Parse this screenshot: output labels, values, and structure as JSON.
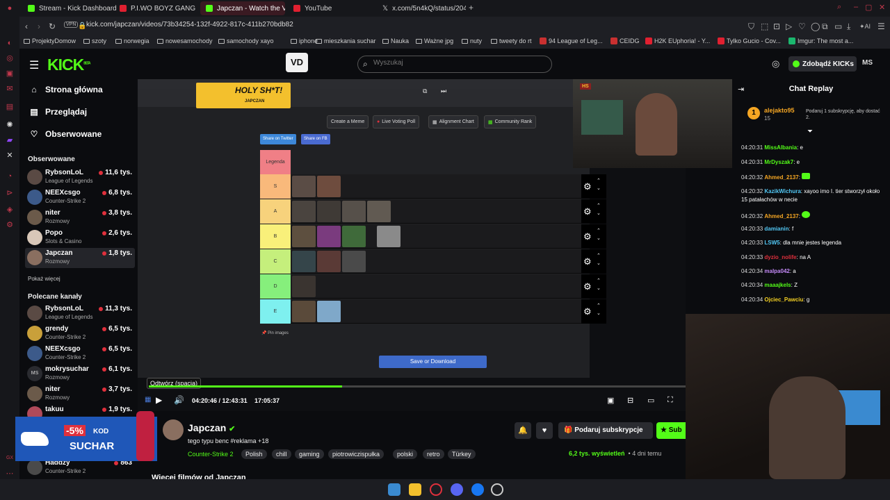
{
  "browser": {
    "tabs": [
      {
        "label": "Stream - Kick Dashboard",
        "color": "#53fc18"
      },
      {
        "label": "P.I.WO BOYZ GANG - SZO",
        "color": "#e02030"
      },
      {
        "label": "Japczan - Watch the VOD",
        "color": "#53fc18"
      },
      {
        "label": "YouTube",
        "color": "#e02030"
      },
      {
        "label": "x.com/5n4kQ/status/2048",
        "color": "#ffffff"
      }
    ],
    "url": "kick.com/japczan/videos/73b34254-132f-4922-817c-411b270bdb82",
    "vpn": "VPN",
    "bookmarks": [
      "ProjektyDomow",
      "szoty",
      "norwegia",
      "nowesamochody",
      "samochody xayo",
      "iphone",
      "mieszkania suchar",
      "Nauka",
      "Ważne jpg",
      "nuty",
      "tweety do rt",
      "94 League of Leg...",
      "CEIDG",
      "H2K EUphoria! - Y...",
      "Tylko Gucio - Cov...",
      "Imgur: The most a..."
    ]
  },
  "header": {
    "logo": "KICK",
    "logo_sup": "BETA",
    "vd_button": "VD",
    "search_placeholder": "Wyszukaj",
    "kicks_button": "Zdobądź KICKs",
    "avatar_initials": "MS"
  },
  "sidebar": {
    "nav": [
      {
        "label": "Strona główna",
        "icon": "home-icon"
      },
      {
        "label": "Przeglądaj",
        "icon": "browse-icon"
      },
      {
        "label": "Obserwowane",
        "icon": "heart-icon"
      }
    ],
    "followed_header": "Obserwowane",
    "followed": [
      {
        "name": "RybsonLoL",
        "game": "League of Legends",
        "viewers": "11,6 tys."
      },
      {
        "name": "NEEXcsgo",
        "game": "Counter-Strike 2",
        "viewers": "6,8 tys."
      },
      {
        "name": "niter",
        "game": "Rozmowy",
        "viewers": "3,8 tys."
      },
      {
        "name": "Popo",
        "game": "Slots & Casino",
        "viewers": "2,6 tys."
      },
      {
        "name": "Japczan",
        "game": "Rozmowy",
        "viewers": "1,8 tys."
      }
    ],
    "show_more": "Pokaż więcej",
    "recommended_header": "Polecane kanały",
    "recommended": [
      {
        "name": "RybsonLoL",
        "game": "League of Legends",
        "viewers": "11,3 tys."
      },
      {
        "name": "grendy",
        "game": "Counter-Strike 2",
        "viewers": "6,5 tys."
      },
      {
        "name": "NEEXcsgo",
        "game": "Counter-Strike 2",
        "viewers": "6,5 tys."
      },
      {
        "name": "mokrysuchar",
        "game": "Rozmowy",
        "viewers": "6,1 tys."
      },
      {
        "name": "niter",
        "game": "Rozmowy",
        "viewers": "3,7 tys."
      },
      {
        "name": "takuu",
        "game": "",
        "viewers": "1,9 tys."
      }
    ],
    "last_channel": {
      "name": "Haddzy",
      "game": "Counter-Strike 2",
      "viewers": "863"
    }
  },
  "video": {
    "overlay_banner": "HOLY SH*T!",
    "overlay_sub": "JAPCZAN",
    "meme_buttons": [
      "Create a Meme",
      "Live Voting Poll",
      "Alignment Chart",
      "Community Rank"
    ],
    "share_buttons": [
      "Share on Twitter",
      "Share on FB"
    ],
    "legend_label": "Legenda",
    "tiers": [
      {
        "label": "S",
        "color": "#f9b97b"
      },
      {
        "label": "A",
        "color": "#f7d27c"
      },
      {
        "label": "B",
        "color": "#f9f07a"
      },
      {
        "label": "C",
        "color": "#c5ef7c"
      },
      {
        "label": "D",
        "color": "#86ef7c"
      },
      {
        "label": "E",
        "color": "#7ef0ef"
      }
    ],
    "pin_images": "Pin images",
    "save_button": "Save or Download",
    "tooltip": "Odtwórz (spacja)",
    "time_current": "04:20:46",
    "time_total": "12:43:31",
    "time_clock": "17:05:37",
    "progress": 0.36
  },
  "chat": {
    "title": "Chat Replay",
    "sub_user": "alejakto95",
    "sub_count": "15",
    "sub_text": "Podaruj 1 subskrypcję, aby dostać 2.",
    "messages": [
      {
        "time": "04:20:31",
        "user": "MissAlbania",
        "color": "#53fc18",
        "text": "e"
      },
      {
        "time": "04:20:31",
        "user": "MrDyszak7",
        "color": "#53fc18",
        "text": "e"
      },
      {
        "time": "04:20:32",
        "user": "Ahmed_2137",
        "color": "#f5a623",
        "text": ""
      },
      {
        "time": "04:20:32",
        "user": "KazikWichura",
        "color": "#52c8f5",
        "text": "xayoo imo I. tier stworzył około 15 patałachów w necie"
      },
      {
        "time": "04:20:32",
        "user": "Ahmed_2137",
        "color": "#f5a623",
        "text": ""
      },
      {
        "time": "04:20:33",
        "user": "damianin",
        "color": "#52c8f5",
        "text": "f"
      },
      {
        "time": "04:20:33",
        "user": "LSW5",
        "color": "#52c8f5",
        "text": "dla mnie jestes legenda"
      },
      {
        "time": "04:20:33",
        "user": "dyzio_nolife",
        "color": "#e0303c",
        "text": "na A"
      },
      {
        "time": "04:20:34",
        "user": "malpa042",
        "color": "#c58af9",
        "text": "a"
      },
      {
        "time": "04:20:34",
        "user": "maaajkels",
        "color": "#53fc18",
        "text": "Z"
      },
      {
        "time": "04:20:34",
        "user": "Ojciec_Pawciu",
        "color": "#f5d123",
        "text": "g"
      }
    ]
  },
  "stream": {
    "name": "Japczan",
    "title": "tego typu benc  #reklama +18",
    "category": "Counter-Strike 2",
    "tags": [
      "Polish",
      "chill",
      "gaming",
      "piotrowiczispułka",
      "polski",
      "retro",
      "Türkey"
    ],
    "views": "6,2 tys. wyświetleń",
    "age": "4 dni temu",
    "gift_button": "Podaruj subskrypcje",
    "sub_button": "Sub",
    "more_videos": "Więcej filmów od Japczan"
  },
  "ad": {
    "discount": "-5%",
    "code_label": "KOD",
    "code": "SUCHAR"
  }
}
